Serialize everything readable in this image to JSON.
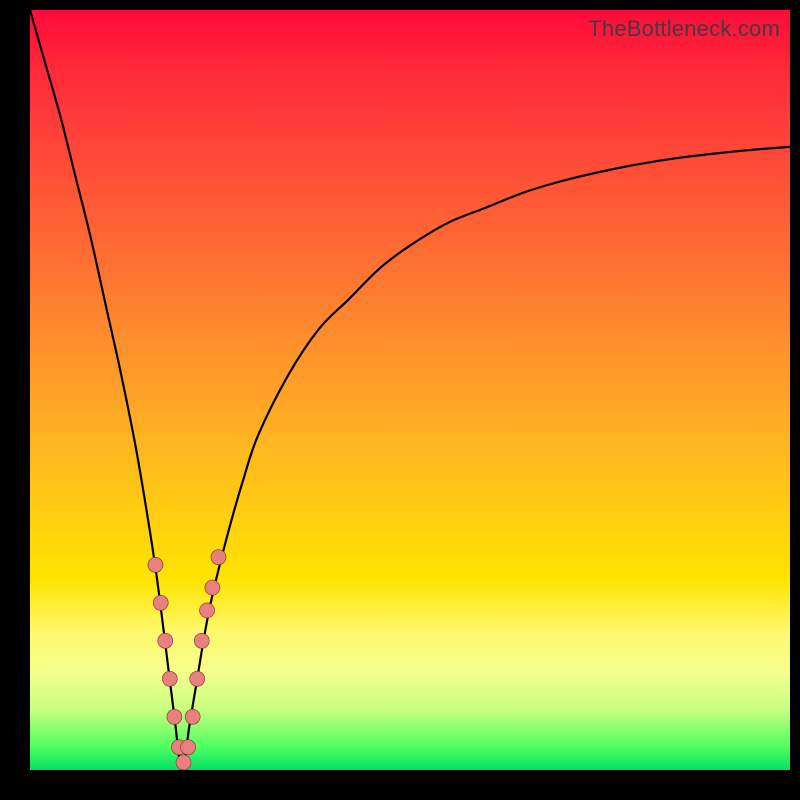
{
  "watermark": "TheBottleneck.com",
  "colors": {
    "frame": "#000000",
    "curve": "#000000",
    "marker_fill": "#e98080",
    "marker_stroke": "#803030",
    "gradient_stops": [
      "#ff0a3a",
      "#ff2a3a",
      "#ff5936",
      "#ff8a2e",
      "#ffb820",
      "#ffe400",
      "#fff870",
      "#f5ff8a",
      "#c8ff80",
      "#4fff60",
      "#00e060"
    ]
  },
  "chart_data": {
    "type": "line",
    "title": "",
    "xlabel": "",
    "ylabel": "",
    "xlim": [
      0,
      100
    ],
    "ylim": [
      0,
      100
    ],
    "note": "V-shaped bottleneck curve. Minimum (0%) near x≈20. Left branch rises to ~100% at x=0; right branch rises asymptotically toward ~82% by x=100.",
    "series": [
      {
        "name": "bottleneck-curve",
        "x": [
          0,
          2,
          4,
          6,
          8,
          10,
          12,
          14,
          16,
          17,
          18,
          19,
          20,
          21,
          22,
          23,
          24,
          26,
          28,
          30,
          34,
          38,
          42,
          46,
          50,
          55,
          60,
          65,
          70,
          75,
          80,
          85,
          90,
          95,
          100
        ],
        "values": [
          100,
          93,
          86,
          78,
          70,
          61,
          52,
          42,
          30,
          23,
          15,
          7,
          0,
          6,
          12,
          18,
          23,
          31,
          38,
          44,
          52,
          58,
          62,
          66,
          69,
          72,
          74,
          76,
          77.5,
          78.7,
          79.7,
          80.5,
          81.1,
          81.6,
          82
        ]
      }
    ],
    "markers": {
      "name": "highlighted-points",
      "x": [
        16.5,
        17.2,
        17.8,
        18.4,
        19.0,
        19.6,
        20.2,
        20.8,
        21.4,
        22.0,
        22.6,
        23.3,
        24.0,
        24.8
      ],
      "values": [
        27,
        22,
        17,
        12,
        7,
        3,
        1,
        3,
        7,
        12,
        17,
        21,
        24,
        28
      ]
    }
  }
}
